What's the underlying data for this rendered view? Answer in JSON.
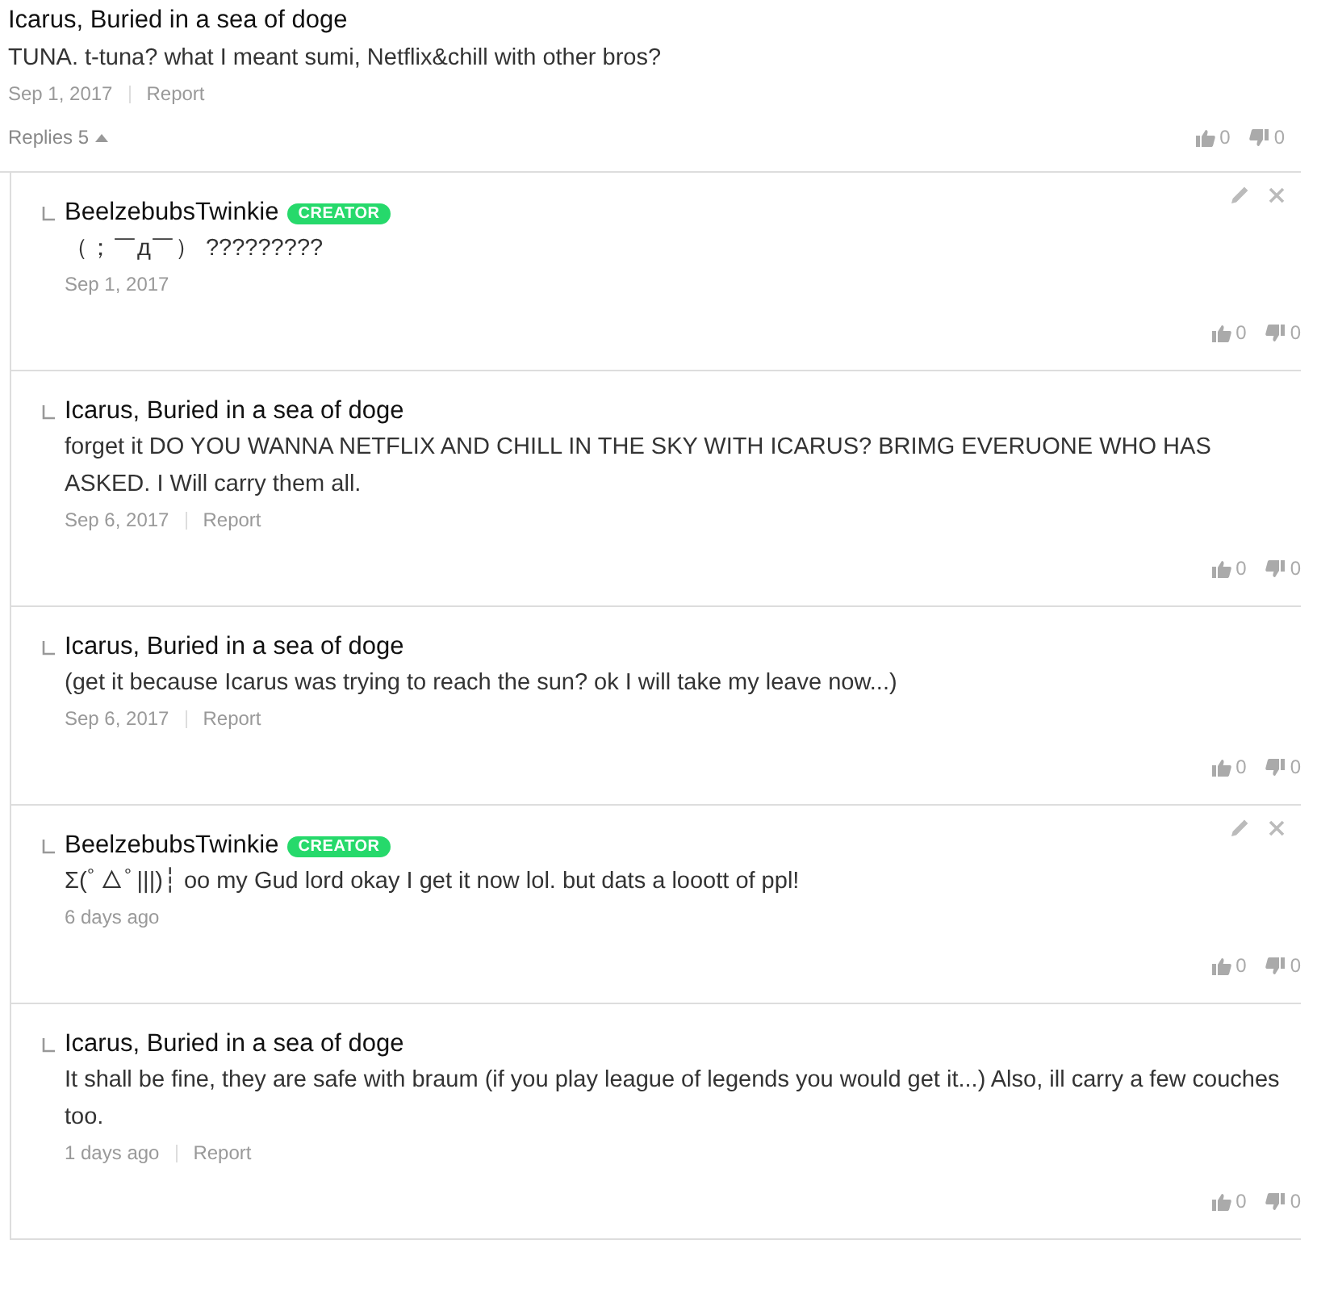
{
  "comment": {
    "author": "Icarus, Buried in a sea of doge",
    "text": "TUNA. t-tuna? what I meant sumi, Netflix&chill with other bros?",
    "date": "Sep 1, 2017",
    "report": "Report",
    "replies_label": "Replies",
    "replies_count": "5",
    "expanded": true,
    "likes": "0",
    "dislikes": "0"
  },
  "replies": [
    {
      "author": "BeelzebubsTwinkie",
      "badge": "CREATOR",
      "editable": true,
      "text": "（；￣д￣） ?????????",
      "date": "Sep 1, 2017",
      "likes": "0",
      "dislikes": "0"
    },
    {
      "author": "Icarus, Buried in a sea of doge",
      "editable": false,
      "text": "forget it DO YOU WANNA NETFLIX AND CHILL IN THE SKY WITH ICARUS? BRIMG EVERUONE WHO HAS ASKED. I Will carry them all.",
      "date": "Sep 6, 2017",
      "report": "Report",
      "likes": "0",
      "dislikes": "0"
    },
    {
      "author": "Icarus, Buried in a sea of doge",
      "editable": false,
      "text": "(get it because Icarus was trying to reach the sun? ok I will take my leave now...)",
      "date": "Sep 6, 2017",
      "report": "Report",
      "likes": "0",
      "dislikes": "0"
    },
    {
      "author": "BeelzebubsTwinkie",
      "badge": "CREATOR",
      "editable": true,
      "text": "Σ(ﾟ△ﾟ|||)┆ oo my Gud lord okay I get it now lol. but dats a looott of ppl!",
      "date": "6 days ago",
      "likes": "0",
      "dislikes": "0"
    },
    {
      "author": "Icarus, Buried in a sea of doge",
      "editable": false,
      "text": "It shall be fine, they are safe with braum (if you play league of legends you would get it...) Also, ill carry a few couches too.",
      "date": "1 days ago",
      "report": "Report",
      "likes": "0",
      "dislikes": "0"
    }
  ]
}
